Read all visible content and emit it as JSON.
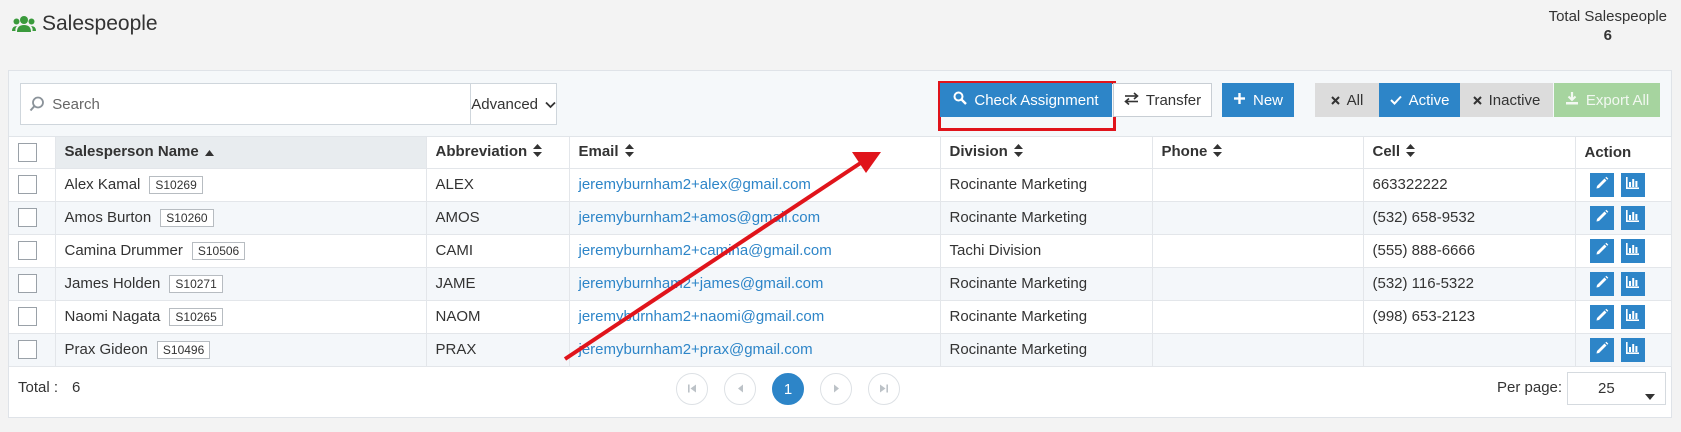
{
  "header": {
    "title": "Salespeople",
    "total_label": "Total Salespeople",
    "total_value": "6"
  },
  "toolbar": {
    "search_placeholder": "Search",
    "advanced_label": "Advanced",
    "check_assignment_label": "Check Assignment",
    "transfer_label": "Transfer",
    "new_label": "New",
    "filter_all_label": "All",
    "filter_active_label": "Active",
    "filter_inactive_label": "Inactive",
    "export_all_label": "Export All"
  },
  "table": {
    "columns": [
      "Salesperson Name",
      "Abbreviation",
      "Email",
      "Division",
      "Phone",
      "Cell",
      "Action"
    ],
    "rows": [
      {
        "name": "Alex Kamal",
        "code": "S10269",
        "abbr": "ALEX",
        "email": "jeremyburnham2+alex@gmail.com",
        "division": "Rocinante Marketing",
        "phone": "",
        "cell": "663322222"
      },
      {
        "name": "Amos Burton",
        "code": "S10260",
        "abbr": "AMOS",
        "email": "jeremyburnham2+amos@gmail.com",
        "division": "Rocinante Marketing",
        "phone": "",
        "cell": "(532) 658-9532"
      },
      {
        "name": "Camina Drummer",
        "code": "S10506",
        "abbr": "CAMI",
        "email": "jeremyburnham2+camina@gmail.com",
        "division": "Tachi Division",
        "phone": "",
        "cell": "(555) 888-6666"
      },
      {
        "name": "James Holden",
        "code": "S10271",
        "abbr": "JAME",
        "email": "jeremyburnham2+james@gmail.com",
        "division": "Rocinante Marketing",
        "phone": "",
        "cell": "(532) 116-5322"
      },
      {
        "name": "Naomi Nagata",
        "code": "S10265",
        "abbr": "NAOM",
        "email": "jeremyburnham2+naomi@gmail.com",
        "division": "Rocinante Marketing",
        "phone": "",
        "cell": "(998) 653-2123"
      },
      {
        "name": "Prax Gideon",
        "code": "S10496",
        "abbr": "PRAX",
        "email": "jeremyburnham2+prax@gmail.com",
        "division": "Rocinante Marketing",
        "phone": "",
        "cell": ""
      }
    ]
  },
  "footer": {
    "total_label": "Total :",
    "total_value": "6",
    "current_page": "1",
    "per_page_label": "Per page:",
    "per_page_value": "25"
  },
  "colors": {
    "primary": "#2d85c8",
    "annotation_red": "#e0141b",
    "export_disabled": "#a6d49f",
    "brand_icon_green": "#3a9a3c"
  },
  "icons": {
    "title": "users-icon",
    "search": "search-icon",
    "advanced": "chevron-down-icon",
    "transfer": "exchange-icon",
    "new": "plus-icon",
    "all": "close-icon",
    "active": "check-icon",
    "inactive": "close-icon",
    "export": "download-icon",
    "edit": "pencil-icon",
    "report": "bar-chart-icon"
  }
}
